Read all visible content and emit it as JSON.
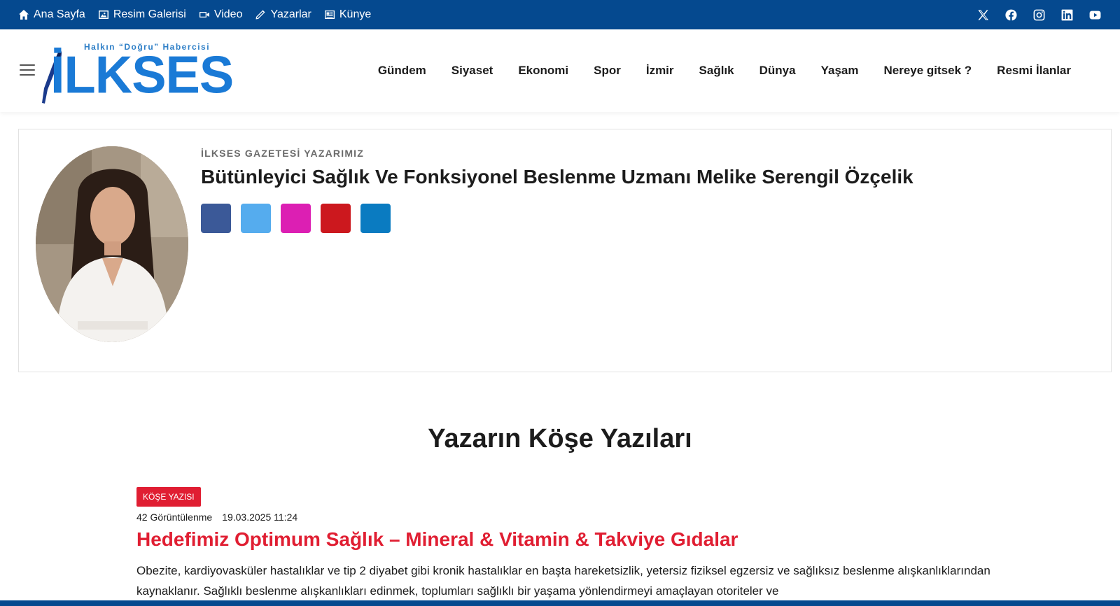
{
  "topbar": {
    "links": [
      {
        "label": "Ana Sayfa",
        "icon": "home-icon"
      },
      {
        "label": "Resim Galerisi",
        "icon": "image-icon"
      },
      {
        "label": "Video",
        "icon": "video-icon"
      },
      {
        "label": "Yazarlar",
        "icon": "pen-icon"
      },
      {
        "label": "Künye",
        "icon": "newspaper-icon"
      }
    ],
    "social": [
      "x-icon",
      "facebook-icon",
      "instagram-icon",
      "linkedin-icon",
      "youtube-icon"
    ],
    "bg_color": "#05498f"
  },
  "header": {
    "logo": {
      "tagline": "Halkın “Doğru” Habercisi",
      "wordmark": "İLKSES"
    },
    "nav": [
      "Gündem",
      "Siyaset",
      "Ekonomi",
      "Spor",
      "İzmir",
      "Sağlık",
      "Dünya",
      "Yaşam",
      "Nereye gitsek ?",
      "Resmi İlanlar"
    ]
  },
  "author": {
    "kicker": "İLKSES GAZETESİ YAZARIMIZ",
    "name": "Bütünleyici Sağlık Ve Fonksiyonel Beslenme Uzmanı Melike Serengil Özçelik",
    "social_colors": [
      "#3b5998",
      "#55acee",
      "#dc1fb3",
      "#cc181e",
      "#0a7bc1"
    ]
  },
  "section": {
    "title": "Yazarın Köşe Yazıları"
  },
  "article": {
    "badge": "KÖŞE YAZISI",
    "views": "42 Görüntülenme",
    "date": "19.03.2025 11:24",
    "title": "Hedefimiz Optimum Sağlık – Mineral & Vitamin & Takviye Gıdalar",
    "excerpt": "Obezite, kardiyovasküler hastalıklar ve tip 2 diyabet gibi kronik hastalıklar en başta hareketsizlik, yetersiz fiziksel egzersiz ve sağlıksız beslenme alışkanlıklarından kaynaklanır. Sağlıklı beslenme alışkanlıkları edinmek, toplumları sağlıklı bir yaşama yönlendirmeyi amaçlayan otoriteler ve"
  },
  "colors": {
    "accent_red": "#e01e32",
    "brand_blue": "#05498f"
  }
}
